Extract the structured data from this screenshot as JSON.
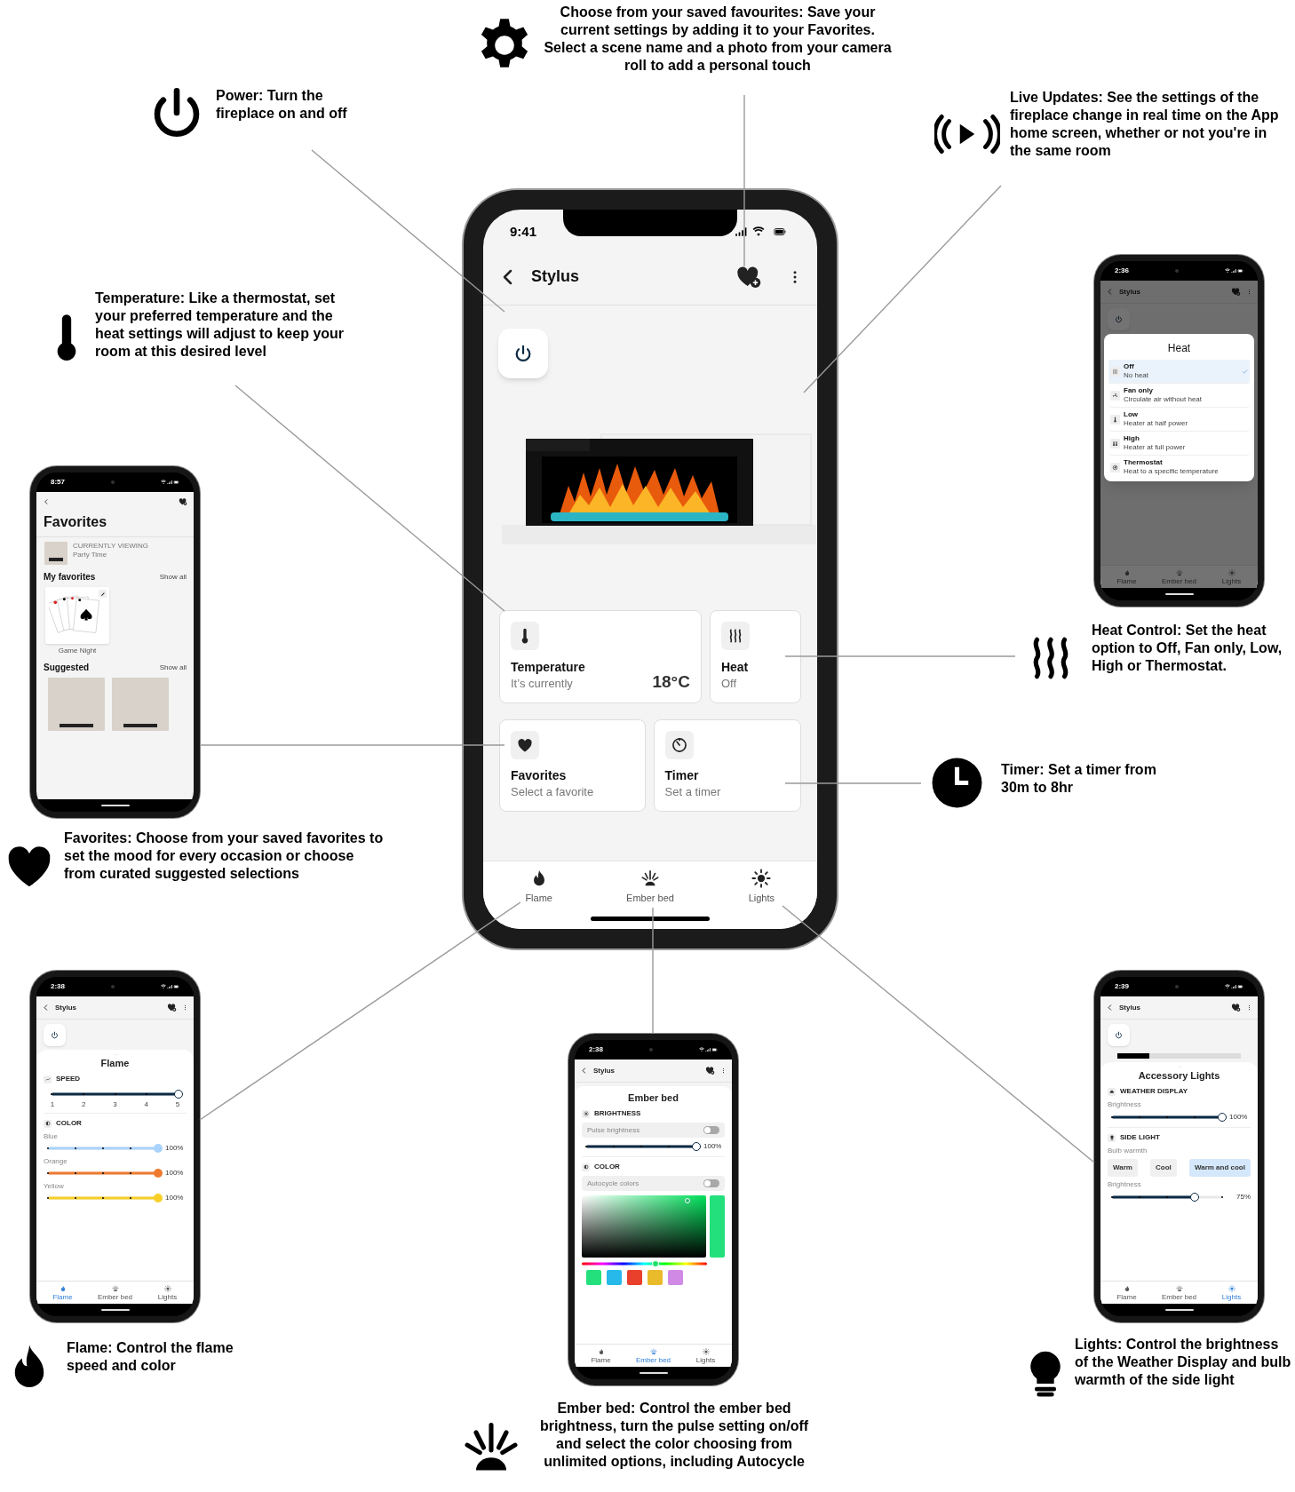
{
  "callouts": [
    {
      "kind": "favorites_scene",
      "text": "Choose from your saved favourites: Save your current settings by adding it to your Favorites. Select a scene name and a photo from your camera roll to add a personal touch"
    },
    {
      "kind": "power",
      "text": "Power: Turn the fireplace on and off"
    },
    {
      "kind": "live_updates",
      "text": "Live Updates: See the settings of the fireplace change in real time on the App home screen, whether or not you're in the same room"
    },
    {
      "kind": "temperature",
      "text": "Temperature: Like a thermostat, set your preferred temperature and the heat settings will adjust to keep your room at this desired level"
    },
    {
      "kind": "heat",
      "text": "Heat Control: Set the heat option to Off, Fan only, Low, High or Thermostat."
    },
    {
      "kind": "timer",
      "text": "Timer: Set a timer from 30m to 8hr"
    },
    {
      "kind": "favorites",
      "text": "Favorites: Choose from your saved favorites to set the mood for every occasion or choose from curated suggested selections"
    },
    {
      "kind": "flame",
      "text": "Flame: Control the flame speed and color"
    },
    {
      "kind": "ember_bed",
      "text": "Ember bed: Control the ember bed brightness, turn the pulse setting on/off and select the color choosing from unlimited options, including Autocycle"
    },
    {
      "kind": "lights",
      "text": "Lights: Control the brightness of the Weather Display and bulb warmth of the side light"
    }
  ],
  "main_phone": {
    "time": "9:41",
    "title": "Stylus",
    "tiles": [
      {
        "kind": "temperature",
        "title": "Temperature",
        "subtitle": "It’s currently",
        "value": "18°C"
      },
      {
        "kind": "heat",
        "title": "Heat",
        "subtitle": "Off"
      },
      {
        "kind": "favorites",
        "title": "Favorites",
        "subtitle": "Select a favorite"
      },
      {
        "kind": "timer",
        "title": "Timer",
        "subtitle": "Set a timer"
      }
    ],
    "nav": [
      {
        "label": "Flame",
        "selected": false
      },
      {
        "label": "Ember bed",
        "selected": false
      },
      {
        "label": "Lights",
        "selected": false
      }
    ]
  },
  "favorites_phone": {
    "time": "8:57",
    "title": "Favorites",
    "current": {
      "label": "CURRENTLY VIEWING",
      "name": "Party Time"
    },
    "my_favorites": {
      "title": "My favorites",
      "action": "Show all",
      "items": [
        {
          "name": "Game Night"
        }
      ]
    },
    "suggested": {
      "title": "Suggested",
      "action": "Show all",
      "items": [
        {
          "kind": "photo"
        },
        {
          "kind": "photo"
        }
      ]
    }
  },
  "heat_phone": {
    "time": "2:36",
    "title": "Stylus",
    "dialog_title": "Heat",
    "options": [
      {
        "kind": "off",
        "label": "Off",
        "description": "No heat",
        "selected": true
      },
      {
        "kind": "fan",
        "label": "Fan only",
        "description": "Circulate air without heat",
        "selected": false
      },
      {
        "kind": "low",
        "label": "Low",
        "description": "Heater at half power",
        "selected": false
      },
      {
        "kind": "high",
        "label": "High",
        "description": "Heater at full power",
        "selected": false
      },
      {
        "kind": "thermostat",
        "label": "Thermostat",
        "description": "Heat to a specific temperature",
        "selected": false
      }
    ],
    "nav": [
      {
        "label": "Flame",
        "selected": false
      },
      {
        "label": "Ember bed",
        "selected": false
      },
      {
        "label": "Lights",
        "selected": false
      }
    ]
  },
  "flame_phone": {
    "time": "2:38",
    "title": "Stylus",
    "sheet_title": "Flame",
    "speed_label": "SPEED",
    "speed": {
      "level": 1,
      "ticks": [
        "1",
        "2",
        "3",
        "4",
        "5"
      ]
    },
    "color_label": "COLOR",
    "colors": [
      {
        "name": "Blue",
        "color": "#a9d3fa",
        "level": 1,
        "reading": "100%"
      },
      {
        "name": "Orange",
        "color": "#ee7a30",
        "level": 1,
        "reading": "100%"
      },
      {
        "name": "Yellow",
        "color": "#f8cf26",
        "level": 1,
        "reading": "100%"
      }
    ],
    "nav": [
      {
        "label": "Flame",
        "selected": true
      },
      {
        "label": "Ember bed",
        "selected": false
      },
      {
        "label": "Lights",
        "selected": false
      }
    ]
  },
  "ember_phone": {
    "time": "2:38",
    "title": "Stylus",
    "sheet_title": "Ember bed",
    "brightness_label": "BRIGHTNESS",
    "pulse": {
      "label": "Pulse brightness",
      "on": false
    },
    "brightness": {
      "level": 1,
      "reading": "100%"
    },
    "color_label": "COLOR",
    "autocycle": {
      "label": "Autocycle colors",
      "on": false
    },
    "hue": {
      "level": 0.59
    },
    "swatches": [
      {
        "color": "#23e07c"
      },
      {
        "color": "#27b9e9"
      },
      {
        "color": "#e8402b"
      },
      {
        "color": "#e9bb2a"
      },
      {
        "color": "#d08ae6"
      }
    ],
    "nav": [
      {
        "label": "Flame",
        "selected": false
      },
      {
        "label": "Ember bed",
        "selected": true
      },
      {
        "label": "Lights",
        "selected": false
      }
    ]
  },
  "lights_phone": {
    "time": "2:39",
    "title": "Stylus",
    "sheet_title": "Accessory Lights",
    "weather_label": "WEATHER DISPLAY",
    "weather_brightness_label": "Brightness",
    "weather_brightness": {
      "level": 1,
      "reading": "100%"
    },
    "side_label": "SIDE LIGHT",
    "warmth_label": "Bulb warmth",
    "warmth_options": [
      {
        "label": "Warm",
        "selected": false
      },
      {
        "label": "Cool",
        "selected": false
      },
      {
        "label": "Warm and cool",
        "selected": true
      }
    ],
    "side_brightness_label": "Brightness",
    "side_brightness": {
      "level": 0.75,
      "reading": "75%"
    },
    "nav": [
      {
        "label": "Flame",
        "selected": false
      },
      {
        "label": "Ember bed",
        "selected": false
      },
      {
        "label": "Lights",
        "selected": true
      }
    ]
  }
}
